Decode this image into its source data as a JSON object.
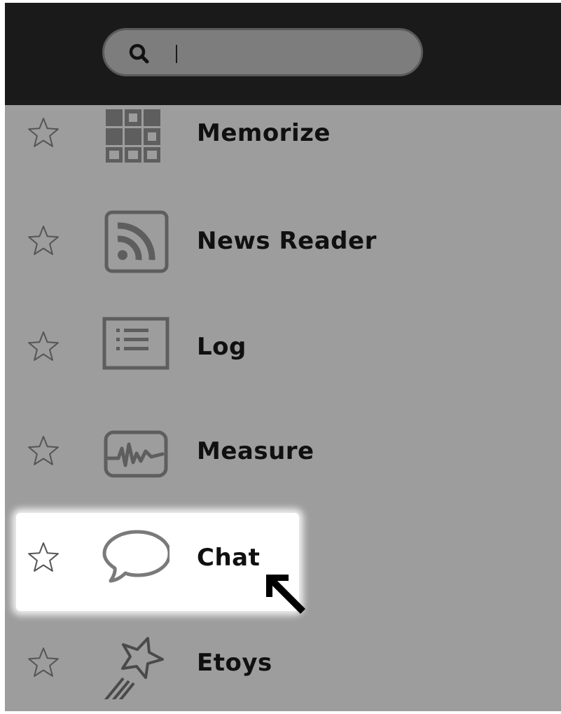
{
  "search": {
    "value": "",
    "placeholder": ""
  },
  "activities": [
    {
      "label": "Memorize",
      "icon": "memorize-icon",
      "favorite": false
    },
    {
      "label": "News Reader",
      "icon": "news-reader-icon",
      "favorite": false
    },
    {
      "label": "Log",
      "icon": "log-icon",
      "favorite": false
    },
    {
      "label": "Measure",
      "icon": "measure-icon",
      "favorite": false
    },
    {
      "label": "Chat",
      "icon": "chat-icon",
      "favorite": false,
      "highlighted": true
    },
    {
      "label": "Etoys",
      "icon": "etoys-icon",
      "favorite": false
    }
  ],
  "colors": {
    "toolbar": "#1a1a1a",
    "list_background": "#9d9d9d",
    "icon_stroke": "#666666",
    "highlight": "#ffffff"
  }
}
